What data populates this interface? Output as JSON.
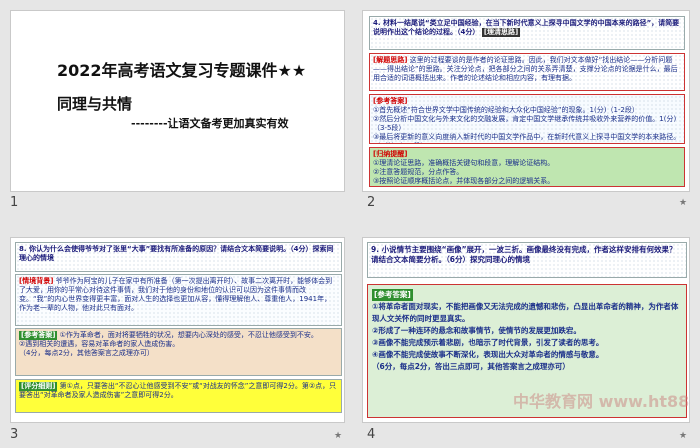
{
  "slides": [
    {
      "number": "1",
      "title": "2022年高考语文复习专题课件★★",
      "subtitle": "同理与共情",
      "tagline": "--------让语文备考更加真实有效"
    },
    {
      "number": "2",
      "question": "4. 材料一结尾说“类立足中国经验，在当下新时代意义上探寻中国文学的中国本来的路径”，请简要说明作出这个结论的过程。（4分）",
      "q_badge": "[理清思路]",
      "analysis_label": "[解题思路]",
      "analysis": "这里的过程要谈的是作者的论证思路。因此，我们对文本做好“找出结论——分析问题——得出结论”的思路。关注分论点，把各部分之间的关系弄清楚，支撑分论点的论据是什么，最后用合适的词语概括出来。作者的论述结论和相应内容，有理有据。",
      "answer_label": "[参考答案]",
      "answers": [
        "①首先概述“符合世界文学中国传统的经验和大众化中国经验”的现象。1(分)（1-2段）",
        "②然后分析中国文化与外来文化的交融发展，肯定中国文学继承传统并吸收外来营养的价值。1(分)（3-5段）",
        "③最后将更新的意义向度纳入新时代的中国文学作品中，在新时代意义上探寻中国文学的本来路径。（2分）（6-7段）"
      ],
      "tip_label": "[归纳提醒]",
      "tips": [
        "①理清论证思路，准确概括关键句和段意，理解论证结构。",
        "②注意答题规范，分点作答。",
        "③按照论证顺序概括论点，并体现各部分之间的逻辑关系。"
      ]
    },
    {
      "number": "3",
      "question": "8. 你认为什么会使得爷爷对了张里“大事”要找有所准备的原因？请结合文本简要说明。（4分）探索同理心的情境",
      "q_badge_a": "简要说明",
      "q_badge_b": "探索同理心的情境",
      "context_label": "[情境背景]",
      "context": "爷爷作为阿宝的儿子在家中有所准备（第一次提出离开时）、故事二次离开时，能够体会到了大爱，用你的平常心对待这件事情，我们对于他的身份和地位的认识可以因为这件事情而改变。“我”的内心世界变得更丰富，面对人生的选择也更加从容，懂得理解他人、尊重他人，1941年，作为老一辈的人物，他对此只有面对。",
      "answer_label": "[参考答案]",
      "answers": [
        "①作为革命者，面对将要牺牲的状况，想要内心深处的感受，不忍让他感受到不安。",
        "②遇到相关的遭遇，容易对革命者的家人造成伤害。"
      ],
      "answer_note": "（4分，每点2分，其他答案言之成理亦可）",
      "grade_label": "[评分细则]",
      "grade": "第①点，只要答出“不忍心让他感受到不安”或“对战友的怀念”之意即可得2分。第②点，只要答出“对革命者及家人造成伤害”之意即可得2分。"
    },
    {
      "number": "4",
      "question": "9. 小说情节主要围绕“画像”展开，一波三折。画像最终没有完成，作者这样安排有何效果？请结合文本简要分析。（6分）探究同理心的情境",
      "answer_label": "[参考答案]",
      "answers": [
        "①将革命者面对现实，不能把画像又无法完成的遗憾和悲伤，凸显出革命者的精神，为作者体现人文关怀的同时更显真实。",
        "②形成了一种连环的悬念和故事情节，使情节的发展更加跌宕。",
        "③画像不能完成预示着悲剧，也暗示了时代背景，引发了读者的思考。",
        "④画像不能完成使故事不断深化，表现出大众对革命者的情感与敬意。"
      ],
      "answer_note": "（6分，每点2分，答出三点即可，其他答案言之成理亦可）"
    }
  ],
  "watermark": "中华教育网 www.ht88.com"
}
